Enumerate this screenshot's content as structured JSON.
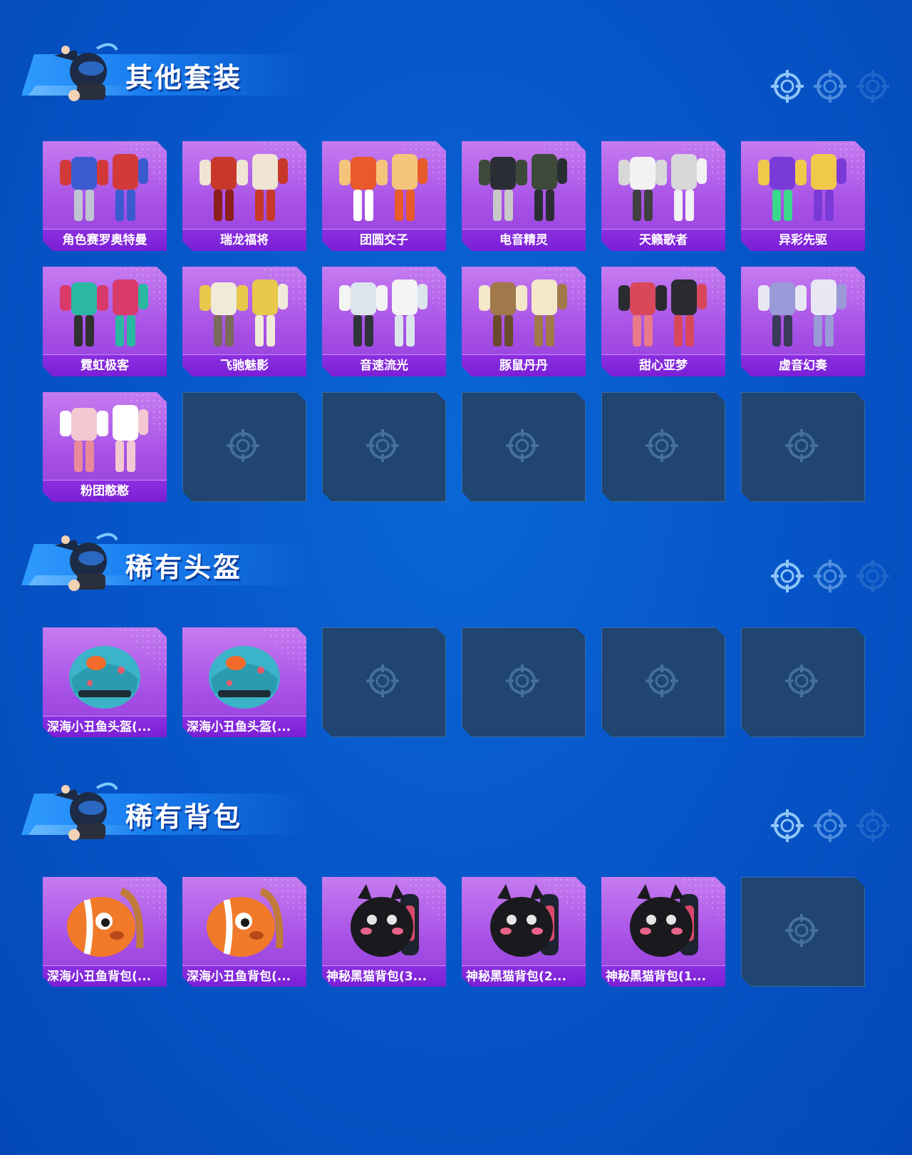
{
  "sections": [
    {
      "title": "其他套装",
      "items": [
        {
          "label": "角色赛罗奥特曼",
          "icon": "suit-hero"
        },
        {
          "label": "瑞龙福将",
          "icon": "suit-red"
        },
        {
          "label": "团圆交子",
          "icon": "suit-orange"
        },
        {
          "label": "电音精灵",
          "icon": "suit-dark"
        },
        {
          "label": "天籁歌者",
          "icon": "suit-white"
        },
        {
          "label": "异彩先驱",
          "icon": "suit-purple"
        },
        {
          "label": "霓虹极客",
          "icon": "suit-teal"
        },
        {
          "label": "飞驰魅影",
          "icon": "suit-cream"
        },
        {
          "label": "音速流光",
          "icon": "suit-silver"
        },
        {
          "label": "豚鼠丹丹",
          "icon": "suit-brown"
        },
        {
          "label": "甜心亚梦",
          "icon": "suit-pink-black"
        },
        {
          "label": "虚音幻奏",
          "icon": "suit-lavender"
        },
        {
          "label": "粉团憨憨",
          "icon": "suit-pink"
        }
      ],
      "empty_slots": 5
    },
    {
      "title": "稀有头盔",
      "items": [
        {
          "label": "深海小丑鱼头盔(...",
          "icon": "helmet-clownfish"
        },
        {
          "label": "深海小丑鱼头盔(...",
          "icon": "helmet-clownfish-2"
        }
      ],
      "empty_slots": 4
    },
    {
      "title": "稀有背包",
      "items": [
        {
          "label": "深海小丑鱼背包(...",
          "icon": "backpack-clownfish"
        },
        {
          "label": "深海小丑鱼背包(...",
          "icon": "backpack-clownfish-2"
        },
        {
          "label": "神秘黑猫背包(3...",
          "icon": "backpack-blackcat"
        },
        {
          "label": "神秘黑猫背包(2...",
          "icon": "backpack-blackcat-2"
        },
        {
          "label": "神秘黑猫背包(1...",
          "icon": "backpack-blackcat-3"
        }
      ],
      "empty_slots": 1
    }
  ],
  "colors": {
    "background": "#0654c7",
    "card_purple": "#a64fe6",
    "label_purple": "#7b1fd6",
    "empty_slot": "#1f4570"
  }
}
